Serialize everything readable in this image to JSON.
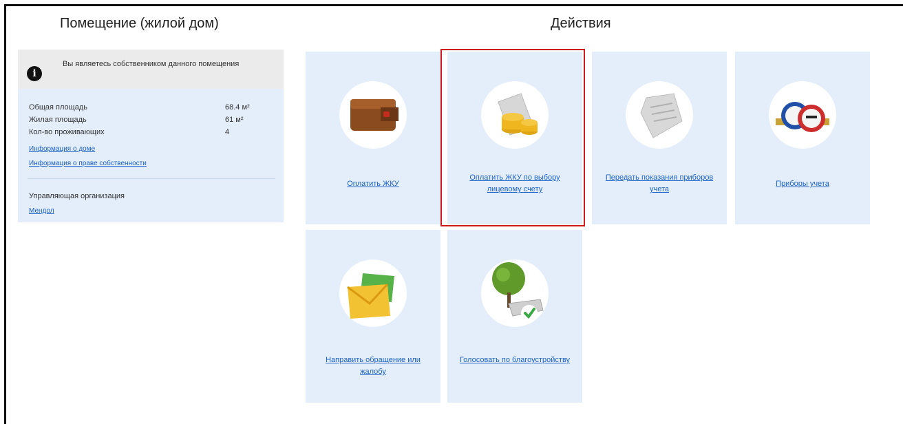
{
  "headers": {
    "left": "Помещение (жилой дом)",
    "right": "Действия"
  },
  "info": {
    "owner_text": "Вы являетесь собственником данного помещения",
    "properties": [
      {
        "label": "Общая площадь",
        "value": "68.4 м²"
      },
      {
        "label": "Жилая площадь",
        "value": "61 м²"
      },
      {
        "label": "Кол-во проживающих",
        "value": "4"
      }
    ],
    "links": {
      "building_info": "Информация о доме",
      "ownership_info": "Информация о праве собственности"
    },
    "management_label": "Управляющая организация",
    "management_link": "Мендол"
  },
  "actions": [
    {
      "label": "Оплатить ЖКУ",
      "icon": "wallet-icon"
    },
    {
      "label": "Оплатить ЖКУ по выбору лицевому счету",
      "icon": "receipt-coins-icon"
    },
    {
      "label": "Передать показания приборов учета",
      "icon": "receipt-icon"
    },
    {
      "label": "Приборы учета",
      "icon": "water-meter-icon"
    },
    {
      "label": "Направить обращение или жалобу",
      "icon": "envelope-icon"
    },
    {
      "label": "Голосовать по благоустройству",
      "icon": "tree-bench-icon"
    }
  ],
  "colors": {
    "tile_bg": "#e3eefa",
    "link": "#1d62c4",
    "highlight": "#cc1b1b"
  }
}
